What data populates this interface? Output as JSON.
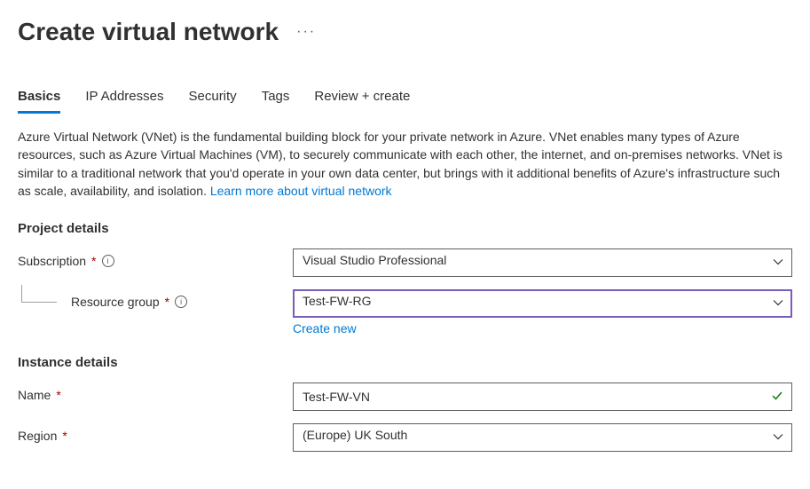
{
  "header": {
    "title": "Create virtual network"
  },
  "tabs": [
    {
      "label": "Basics",
      "active": true
    },
    {
      "label": "IP Addresses",
      "active": false
    },
    {
      "label": "Security",
      "active": false
    },
    {
      "label": "Tags",
      "active": false
    },
    {
      "label": "Review + create",
      "active": false
    }
  ],
  "description": {
    "text": "Azure Virtual Network (VNet) is the fundamental building block for your private network in Azure. VNet enables many types of Azure resources, such as Azure Virtual Machines (VM), to securely communicate with each other, the internet, and on-premises networks. VNet is similar to a traditional network that you'd operate in your own data center, but brings with it additional benefits of Azure's infrastructure such as scale, availability, and isolation.  ",
    "link_text": "Learn more about virtual network"
  },
  "sections": {
    "project": {
      "title": "Project details",
      "subscription": {
        "label": "Subscription",
        "value": "Visual Studio Professional"
      },
      "resource_group": {
        "label": "Resource group",
        "value": "Test-FW-RG",
        "create_new": "Create new"
      }
    },
    "instance": {
      "title": "Instance details",
      "name": {
        "label": "Name",
        "value": "Test-FW-VN"
      },
      "region": {
        "label": "Region",
        "value": "(Europe) UK South"
      }
    }
  }
}
